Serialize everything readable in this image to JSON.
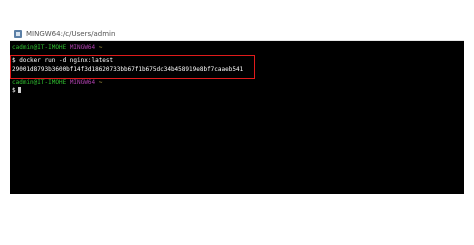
{
  "window": {
    "title": "MINGW64:/c/Users/admin",
    "icon": "terminal-icon"
  },
  "terminal": {
    "prompt1": {
      "user_host": "cadmin@IT-IMOHE",
      "env": "MINGW64",
      "path": "~"
    },
    "command": "$ docker run -d nginx:latest",
    "output": "29001d8793b3600bf14f3d18620733bb67f1b675dc34b458919e8bf7caaeb541",
    "prompt2": {
      "user_host": "cadmin@IT-IMOHE",
      "env": "MINGW64",
      "path": "~"
    },
    "prompt_symbol": "$"
  },
  "colors": {
    "highlight_border": "#e01b1b",
    "terminal_bg": "#000000",
    "user_host": "#2fbf2f",
    "env": "#b040b0",
    "path": "#c8b44a"
  }
}
